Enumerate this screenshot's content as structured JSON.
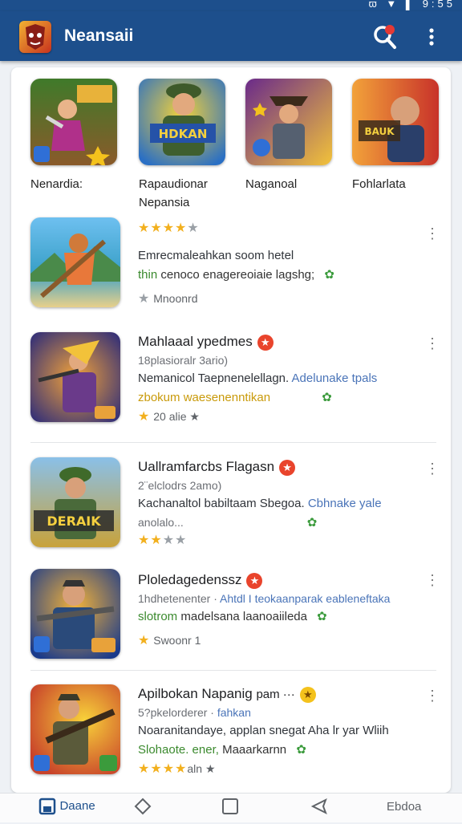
{
  "status_bar": {
    "time": "9:55",
    "icons": "ϖ ▼ ▌"
  },
  "app_bar": {
    "title": "Neansaii",
    "search_icon": "search-icon",
    "menu_icon": "more-vert-icon"
  },
  "featured": [
    {
      "label": "Nenardia:",
      "badge": "B"
    },
    {
      "label": "Rapaudionar Nepansia",
      "badge": ""
    },
    {
      "label": "Naganoal",
      "badge": ""
    },
    {
      "label": "Fohlarlata",
      "badge": ""
    }
  ],
  "rows": [
    {
      "title": "",
      "stars_on": "★★★★",
      "stars_off": "★",
      "desc": "Emrecmaleahkan soom hetel",
      "desc_blue": "",
      "tags_green": "thin",
      "tags": "cenoco enagereoiaie lagshg;",
      "tags_amber": "",
      "rating_star": "★",
      "rating_text": "Mnoonrd"
    },
    {
      "title": "Mahlaaal ypedmes",
      "badge": "★",
      "sub": "18plasioralr 3ario)",
      "desc": "Nemanicol Taepnenelellagn.",
      "desc_blue": "Adelunake tpals",
      "tags_amber": "zbokum waesenenntikan",
      "rating_star": "★",
      "rating_text": "20 alie ★"
    },
    {
      "title": "Uallramfarcbs Flagasn",
      "badge": "★",
      "sub": "2¨elclodrs 2amo)",
      "desc": "Kachanaltol babiltaam Sbegoa.",
      "desc_blue": "Cbhnake yale",
      "tags": "anolalo...",
      "stars_on": "★★",
      "stars_off": "★★",
      "rating_text": ""
    },
    {
      "title": "Ploledagedenssz",
      "badge": "★",
      "sub": "1hdhetenenter ·",
      "sub_blue": "Ahtdl I teokaanparak eableneftaka",
      "tags_green": "slotrom",
      "tags": "madelsana laanoaiileda",
      "rating_star": "★",
      "rating_text": "Swoonr 1"
    },
    {
      "title": "Apilbokan Napanig",
      "title_extra": "pam ···",
      "badge": "★",
      "sub": "5?pkelorderer ·",
      "sub_blue": "fahkan",
      "desc": "Noaranitandaye, applan snegat Aha lr yar Wliih",
      "tags_green": "Slohaote. ener,",
      "tags": "Maaarkarnn",
      "stars_on": "★★★★",
      "rating_text": "aln ★"
    }
  ],
  "bottom_nav": [
    {
      "label": "Daane",
      "icon": "bookmark-icon"
    },
    {
      "label": "",
      "icon": "diamond-icon"
    },
    {
      "label": "",
      "icon": "square-icon"
    },
    {
      "label": "",
      "icon": "back-icon"
    },
    {
      "label": "Ebdoa",
      "icon": ""
    }
  ],
  "colors": {
    "app_bar": "#1d4f8c",
    "star": "#f2b01e",
    "accent_blue": "#4a74b8",
    "green": "#3b8a2e",
    "badge_red": "#e9442c"
  }
}
